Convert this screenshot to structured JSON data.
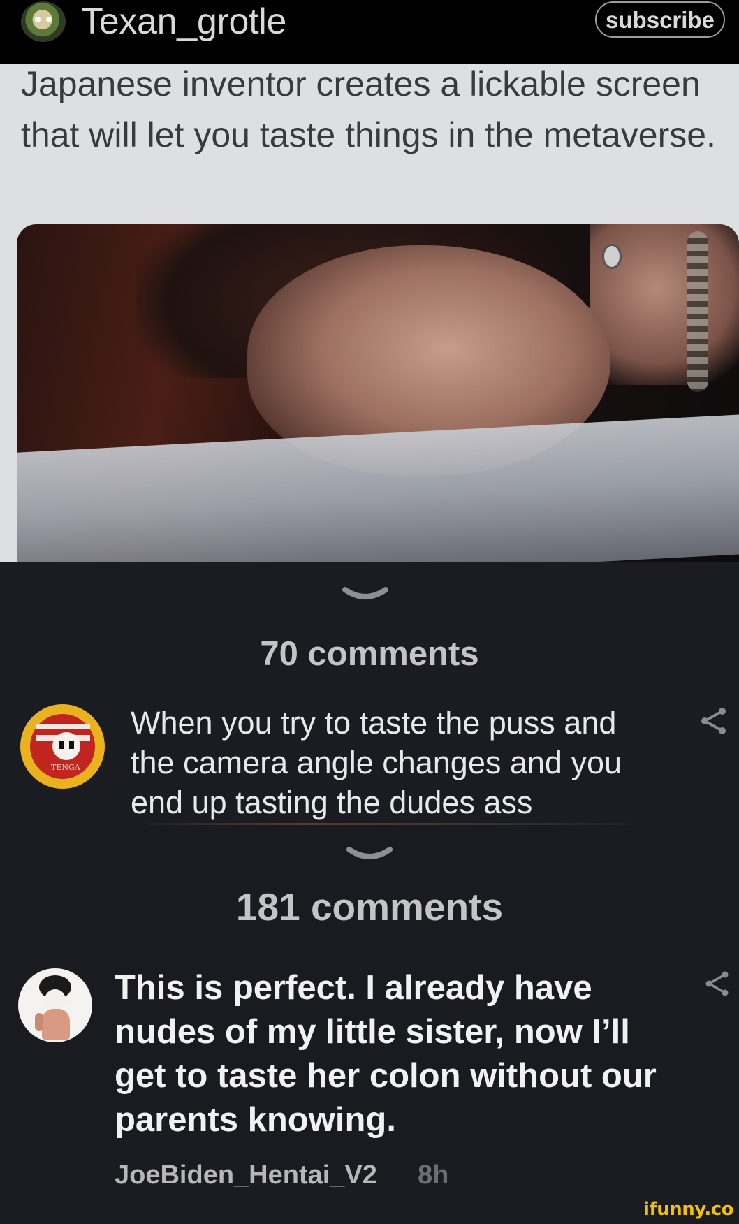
{
  "header": {
    "username": "Texan_grotle",
    "subscribe_label": "subscribe"
  },
  "post": {
    "tweet_text": "Japanese inventor creates a lickable screen that will let you taste things in the metaverse."
  },
  "comments_section_1": {
    "count_label": "70 comments",
    "comment": {
      "text": "When you try to taste the puss and the camera angle changes and you end up tasting the dudes ass",
      "avatar_label": "TENGA"
    }
  },
  "comments_section_2": {
    "count_label": "181 comments",
    "comment": {
      "text": "This is perfect. I already have nudes of my little sister, now I’ll get to taste her colon without our parents knowing.",
      "author": "JoeBiden_Hentai_V2",
      "time": "8h"
    }
  },
  "watermark": "ifunny.co",
  "colors": {
    "background": "#1a1b20",
    "header": "#000000",
    "tweet_background": "#dedfe2",
    "watermark": "#f2c200"
  },
  "icons": [
    "chevron-down-icon",
    "share-icon"
  ]
}
